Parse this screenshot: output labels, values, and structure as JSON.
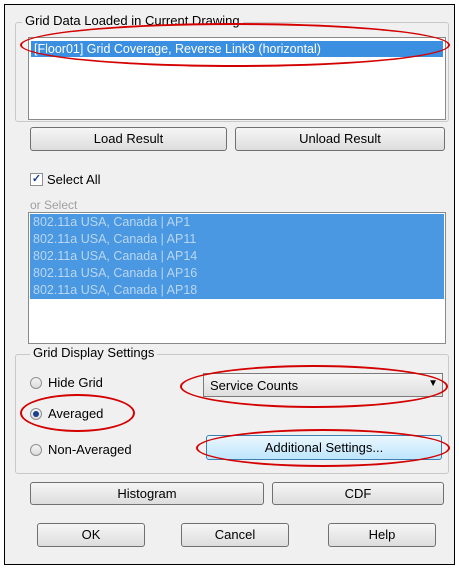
{
  "grid_data": {
    "title": "Grid Data Loaded in Current Drawing",
    "selected_item": "[Floor01] Grid Coverage, Reverse Link9 (horizontal)"
  },
  "buttons": {
    "load_result": "Load Result",
    "unload_result": "Unload Result",
    "histogram": "Histogram",
    "cdf": "CDF",
    "ok": "OK",
    "cancel": "Cancel",
    "help": "Help",
    "additional_settings": "Additional Settings..."
  },
  "select_all": {
    "label": "Select All",
    "checked": true
  },
  "or_select": {
    "label": "or Select",
    "items": [
      "802.11a USA, Canada | AP1",
      "802.11a USA, Canada | AP11",
      "802.11a USA, Canada | AP14",
      "802.11a USA, Canada | AP16",
      "802.11a USA, Canada | AP18"
    ]
  },
  "display_settings": {
    "title": "Grid Display Settings",
    "options": [
      "Hide Grid",
      "Averaged",
      "Non-Averaged"
    ],
    "selected": "Averaged",
    "dropdown_value": "Service Counts"
  },
  "colors": {
    "highlight": "#3a8fe0",
    "annotation": "#d40000"
  }
}
